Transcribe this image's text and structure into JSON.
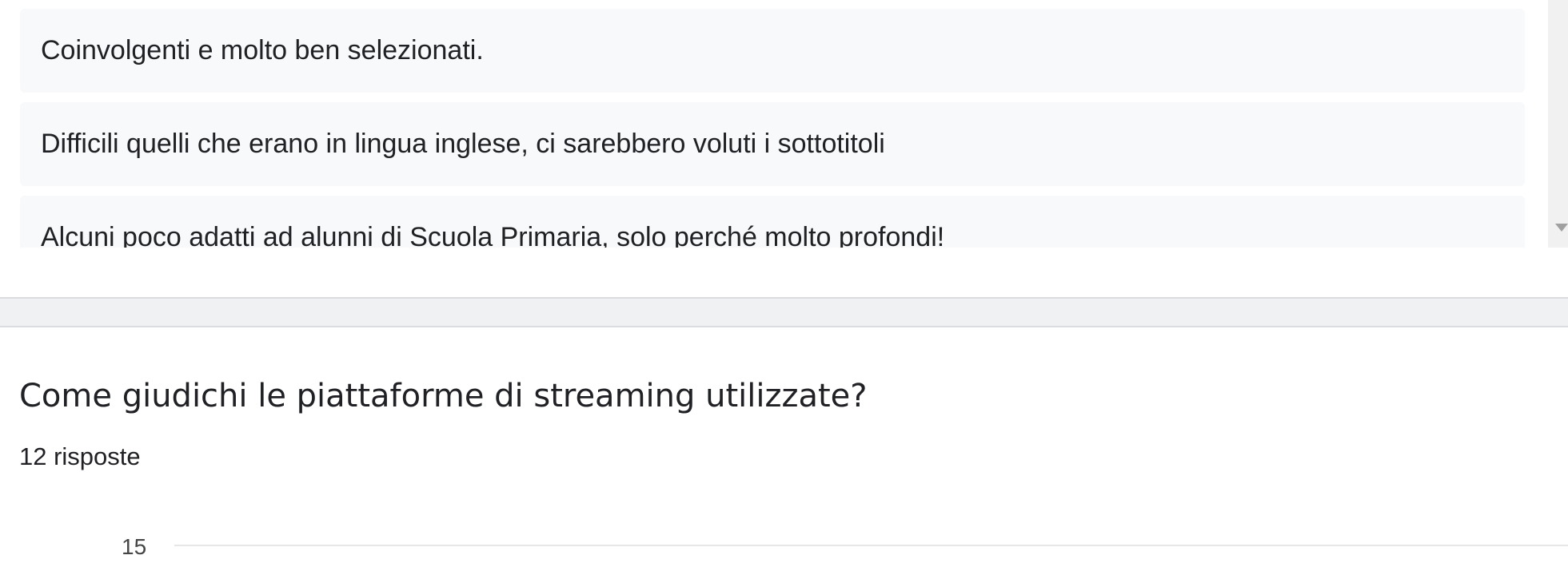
{
  "previous_question": {
    "responses": [
      "Coinvolgenti e molto ben selezionati.",
      "Difficili quelli che erano in lingua inglese, ci sarebbero voluti i sottotitoli",
      "Alcuni poco adatti ad alunni di Scuola Primaria, solo perché molto profondi!"
    ]
  },
  "question": {
    "title": "Come giudichi le piattaforme di streaming utilizzate?",
    "response_count": "12 risposte"
  },
  "chart_data": {
    "type": "bar",
    "y_ticks_visible": [
      "15"
    ],
    "ylim_top_visible": 15
  },
  "colors": {
    "response_bg": "#f8f9fa",
    "separator_bg": "#f0f1f3",
    "text": "#202124"
  }
}
